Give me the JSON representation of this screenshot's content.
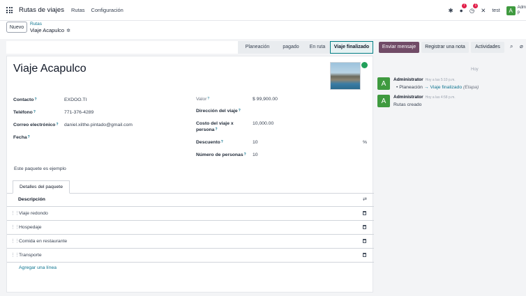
{
  "navbar": {
    "app_title": "Rutas de viajes",
    "menu": [
      "Rutas",
      "Configuración"
    ],
    "messages_count": "7",
    "activities_count": "1",
    "company": "test",
    "user_initial": "A",
    "user_name": "Adm",
    "user_sub": "p"
  },
  "controlbar": {
    "new_label": "Nuevo",
    "breadcrumb_parent": "Rutas",
    "breadcrumb_current": "Viaje Acapulco"
  },
  "statusbar": {
    "stages": [
      "Planeación",
      "pagado",
      "En ruta",
      "Viaje finalizado"
    ],
    "active_index": 3
  },
  "form": {
    "title": "Viaje Acapulco",
    "status_color": "#22a05a",
    "left": [
      {
        "label": "Contacto",
        "value": "EXDOO.TI"
      },
      {
        "label": "Teléfono",
        "value": "771-376-4289"
      },
      {
        "label": "Correo electrónico",
        "value": "daniel.xilthe.pintado@gmail.com"
      },
      {
        "label": "Fecha",
        "value": ""
      }
    ],
    "right": [
      {
        "label": "Valor",
        "value": "$ 99,900.00"
      },
      {
        "label": "Dirección del viaje",
        "value": ""
      },
      {
        "label": "Costo del viaje x persona",
        "value": "10,000.00"
      },
      {
        "label": "Descuento",
        "value": "10",
        "suffix": "%"
      },
      {
        "label": "Número de personas",
        "value": "10"
      }
    ],
    "note": "Este paquete es ejemplo",
    "tab_label": "Detalles del paquete",
    "table_header": "Descripción",
    "rows": [
      "Viaje redondo",
      "Hospedaje",
      "Comida en restaurante",
      "Transporte"
    ],
    "add_line": "Agregar una línea"
  },
  "chatter": {
    "send_message": "Enviar mensaje",
    "log_note": "Registrar una nota",
    "activities": "Actividades",
    "day_label": "Hoy",
    "messages": [
      {
        "author": "Administrator",
        "time": "Hoy a las 5:10 p.m.",
        "from": "Planeación",
        "to": "Viaje finalizado",
        "field": "(Etapa)"
      },
      {
        "author": "Administrator",
        "time": "Hoy a las 4:58 p.m.",
        "text": "Rutas creado"
      }
    ]
  },
  "colors": {
    "accent": "#714b67",
    "link": "#0e7490",
    "avatar": "#3f9a3f"
  }
}
